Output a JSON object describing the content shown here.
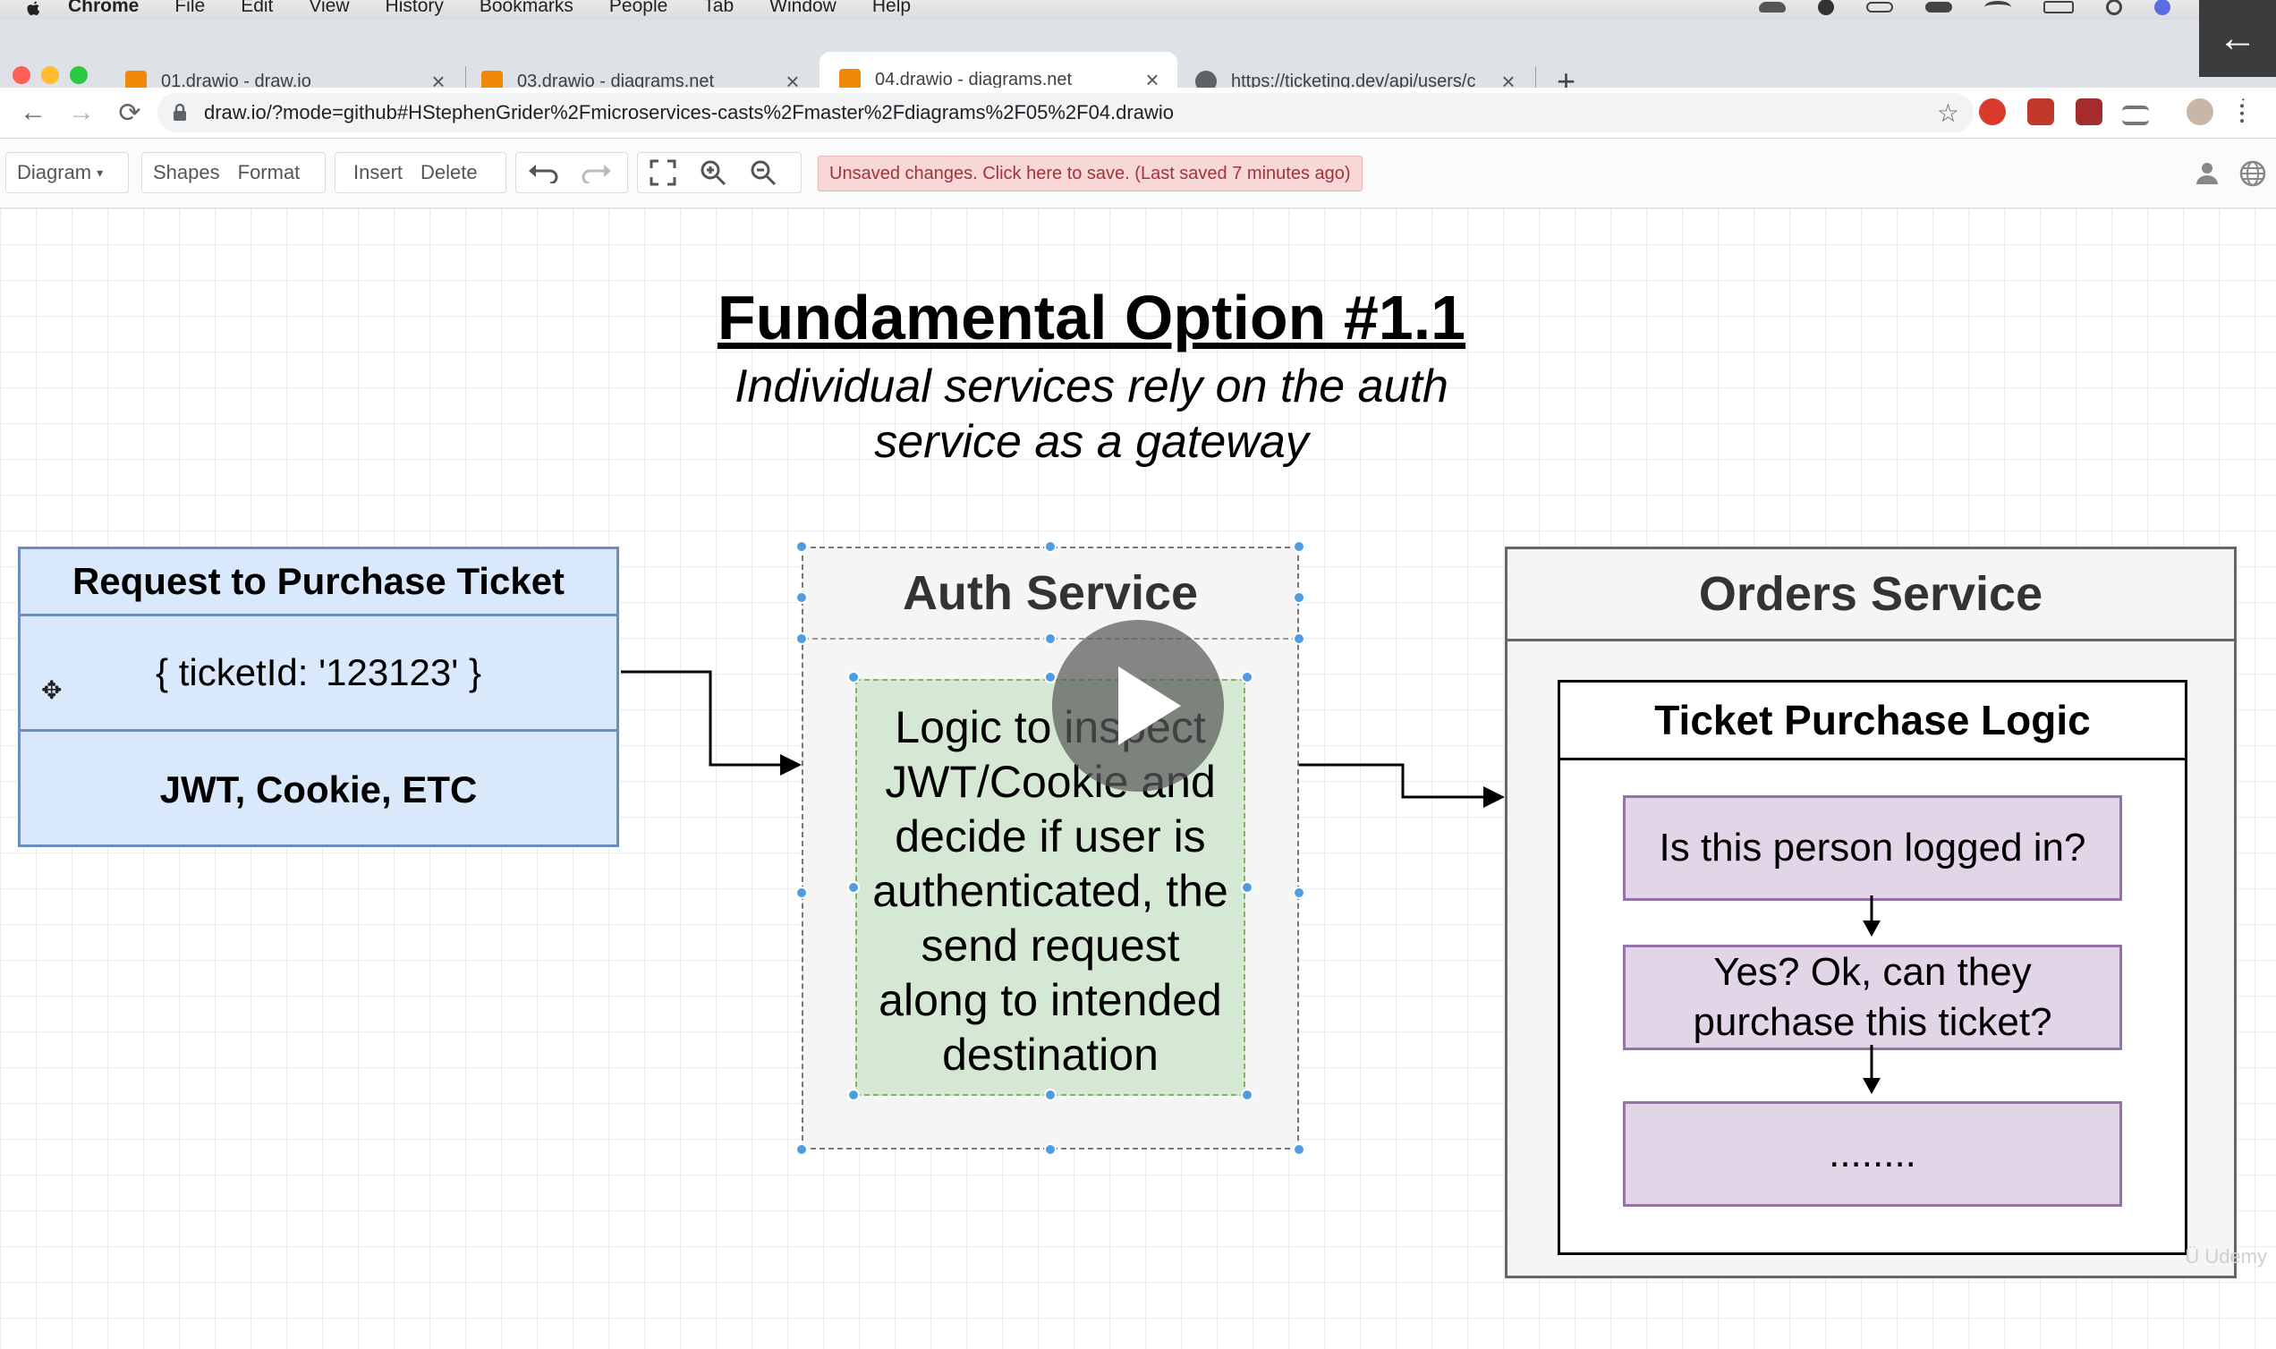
{
  "menubar": {
    "app": "Chrome",
    "items": [
      "File",
      "Edit",
      "View",
      "History",
      "Bookmarks",
      "People",
      "Tab",
      "Window",
      "Help"
    ]
  },
  "tabs": [
    {
      "title": "01.drawio - draw.io",
      "favicon": "drawio-icon"
    },
    {
      "title": "03.drawio - diagrams.net",
      "favicon": "drawio-icon"
    },
    {
      "title": "04.drawio - diagrams.net",
      "favicon": "drawio-icon",
      "active": true
    },
    {
      "title": "https://ticketing.dev/api/users/c",
      "favicon": "globe-icon"
    }
  ],
  "address": {
    "url": "draw.io/?mode=github#HStephenGrider%2Fmicroservices-casts%2Fmaster%2Fdiagrams%2F05%2F04.drawio"
  },
  "toolbar": {
    "diagram": "Diagram",
    "shapes": "Shapes",
    "format": "Format",
    "insert": "Insert",
    "delete": "Delete",
    "unsaved": "Unsaved changes. Click here to save. (Last saved 7 minutes ago)"
  },
  "diagram": {
    "title": "Fundamental Option #1.1",
    "subtitle_line1": "Individual services rely on the auth",
    "subtitle_line2": "service as a gateway",
    "request": {
      "header": "Request to Purchase Ticket",
      "body": "{ ticketId: '123123' }",
      "footer": "JWT, Cookie, ETC"
    },
    "auth": {
      "title": "Auth Service",
      "logic_lines": [
        "Logic to inspect",
        "JWT/Cookie and",
        "decide if user is",
        "authenticated, the",
        "send request",
        "along to intended",
        "destination"
      ]
    },
    "orders": {
      "title": "Orders Service",
      "inner_title": "Ticket Purchase Logic",
      "step1": "Is this person logged in?",
      "step2_line1": "Yes? Ok, can they",
      "step2_line2": "purchase this ticket?",
      "step3": "........"
    }
  },
  "colors": {
    "request_fill": "#dae8fc",
    "request_stroke": "#6c8ebf",
    "logic_fill": "#d5e8d4",
    "step_fill": "#e1d5e7",
    "selection": "#4d9de0",
    "unsaved_bg": "#f8d7d7"
  }
}
